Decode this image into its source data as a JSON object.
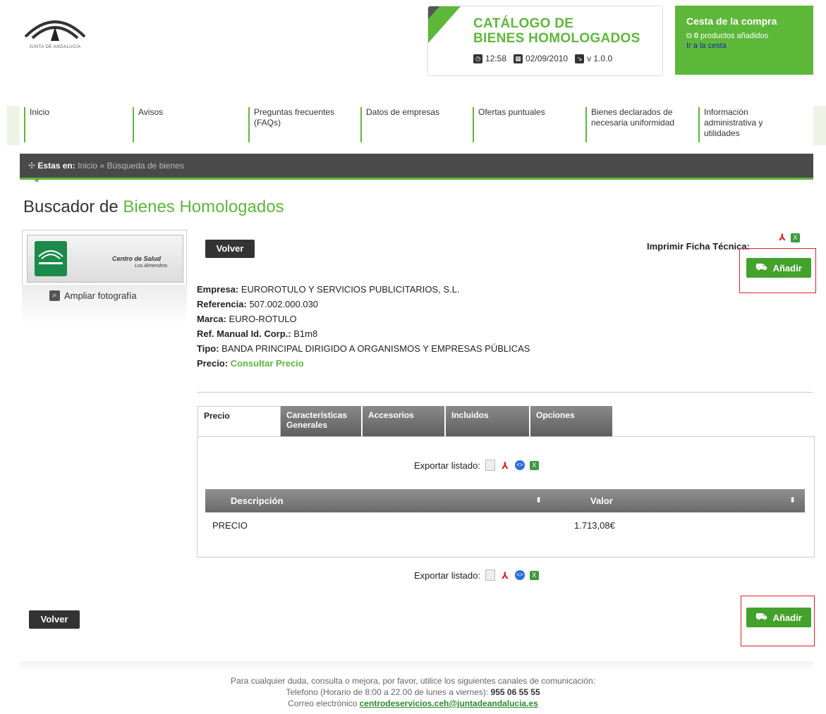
{
  "header": {
    "logo_text": "JUNTA DE ANDALUCIA",
    "catalog_title_line1": "CATÁLOGO DE",
    "catalog_title_line2": "BIENES HOMOLOGADOS",
    "time": "12:58",
    "date": "02/09/2010",
    "version": "v 1.0.0"
  },
  "cart": {
    "title": "Cesta de la compra",
    "count": "0",
    "count_suffix": " productos añadidos",
    "link": "Ir a la cesta"
  },
  "nav": {
    "items": [
      {
        "label": "Inicio"
      },
      {
        "label": "Avisos"
      },
      {
        "label": "Preguntas frecuentes (FAQs)"
      },
      {
        "label": "Datos de empresas"
      },
      {
        "label": "Ofertas puntuales"
      },
      {
        "label": "Bienes declarados de necesaria uniformidad"
      },
      {
        "label": "Información administrativa y utilidades"
      }
    ]
  },
  "breadcrumb": {
    "prefix": "Estas en:",
    "home": "Inicio",
    "separator": "»",
    "current": "Búsqueda de bienes"
  },
  "page": {
    "title_part1": "Buscador de ",
    "title_part2": "Bienes Homologados"
  },
  "photo": {
    "label1": "Centro de Salud",
    "label2": "Los Almendros",
    "enlarge": "Ampliar fotografía"
  },
  "actions": {
    "back": "Volver",
    "add": "Añadir",
    "print_label": "Imprimir Ficha Técnica:"
  },
  "product": {
    "empresa_label": "Empresa:",
    "empresa": "EUROROTULO Y SERVICIOS PUBLICITARIOS, S.L.",
    "referencia_label": "Referencia:",
    "referencia": "507.002.000.030",
    "marca_label": "Marca:",
    "marca": "EURO-ROTULO",
    "ref_manual_label": "Ref. Manual Id. Corp.:",
    "ref_manual": "B1m8",
    "tipo_label": "Tipo:",
    "tipo": "BANDA PRINCIPAL DIRIGIDO A ORGANISMOS Y EMPRESAS PÚBLICAS",
    "precio_label": "Precio:",
    "precio": "Consultar Precio"
  },
  "tabs": [
    {
      "label": "Precio",
      "active": true
    },
    {
      "label": "Características Generales"
    },
    {
      "label": "Accesorios"
    },
    {
      "label": "Incluidos"
    },
    {
      "label": "Opciones"
    }
  ],
  "export_label": "Exportar listado:",
  "table": {
    "columns": [
      "Descripción",
      "Valor"
    ],
    "rows": [
      [
        "PRECIO",
        "1.713,08€"
      ]
    ]
  },
  "footer": {
    "line1": "Para cualquier duda, consulta o mejora, por favor, utilice los siguientes canales de comunicación:",
    "line2_prefix": "Telefono (Horario de 8:00 a 22.00 de lunes a viernes): ",
    "phone": "955 06 55 55",
    "line3_prefix": "Correo electrónico ",
    "email": "centrodeservicios.ceh@juntadeandalucia.es"
  },
  "colors": {
    "brand_green": "#5db83a",
    "button_green": "#43a22c",
    "highlight_red": "#e0202a",
    "dark_bar": "#4a4a4a"
  }
}
